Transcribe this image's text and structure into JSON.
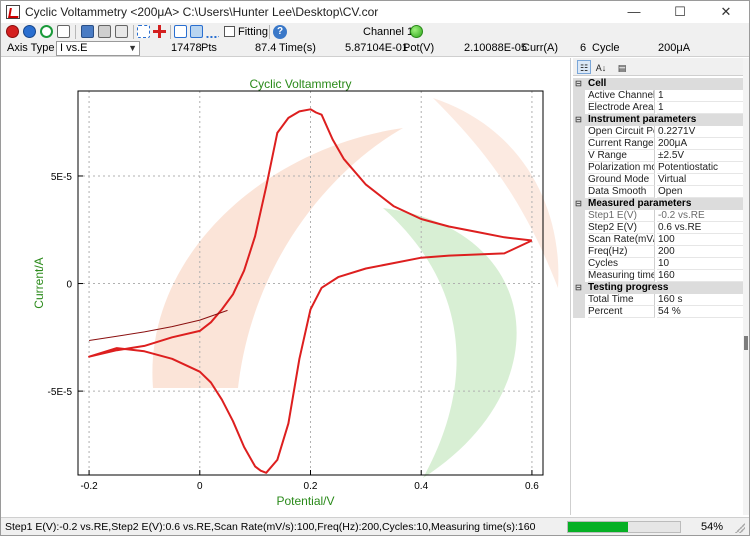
{
  "window": {
    "title": "Cyclic Voltammetry <200μA>  C:\\Users\\Hunter Lee\\Desktop\\CV.cor",
    "minimize": "—",
    "maximize": "☐",
    "close": "✕"
  },
  "toolbar": {
    "fitting_label": "Fitting",
    "help_glyph": "?",
    "channel_label": "Channel 1",
    "channel_status_color": "#2fa81c"
  },
  "infobar": {
    "axis_type_label": "Axis Type",
    "axis_type_value": "I vs.E",
    "points_value": "17478",
    "points_unit": "Pts",
    "time_value": "87.4",
    "time_unit": "Time(s)",
    "pot_value": "5.87104E-01",
    "pot_unit": "Pot(V)",
    "curr_value": "2.10088E-05",
    "curr_unit": "Curr(A)",
    "cycle_value": "6",
    "cycle_unit": "Cycle",
    "range_value": "200μA"
  },
  "chart_data": {
    "type": "line",
    "title": "Cyclic Voltammetry",
    "xlabel": "Potential/V",
    "ylabel": "Current/A",
    "xlim": [
      -0.22,
      0.62
    ],
    "ylim": [
      -8.9e-05,
      8.95e-05
    ],
    "xticks": [
      -0.2,
      0,
      0.2,
      0.4,
      0.6
    ],
    "xtick_labels": [
      "-0.2",
      "0",
      "0.2",
      "0.4",
      "0.6"
    ],
    "yticks": [
      5e-05,
      0,
      -5e-05
    ],
    "ytick_labels": [
      "5E-5",
      "0",
      "-5E-5"
    ],
    "grid": "dashed",
    "series": [
      {
        "color": "#dd1f1f",
        "x": [
          0.6,
          0.55,
          0.5,
          0.45,
          0.4,
          0.35,
          0.3,
          0.25,
          0.22,
          0.2,
          0.18,
          0.16,
          0.14,
          0.12,
          0.11,
          0.1,
          0.08,
          0.06,
          0.04,
          0.02,
          0.0,
          -0.05,
          -0.1,
          -0.15,
          -0.2,
          -0.15,
          -0.1,
          -0.05,
          0.0,
          0.02,
          0.04,
          0.06,
          0.08,
          0.1,
          0.12,
          0.14,
          0.16,
          0.18,
          0.2,
          0.21,
          0.22,
          0.24,
          0.26,
          0.3,
          0.35,
          0.4,
          0.45,
          0.5,
          0.55,
          0.6
        ],
        "y": [
          2e-05,
          1.4e-05,
          1.35e-05,
          1.3e-05,
          1.2e-05,
          9.5e-06,
          7e-06,
          3e-06,
          -2e-06,
          -1.2e-05,
          -3.5e-05,
          -6.5e-05,
          -8.2e-05,
          -8.8e-05,
          -8.7e-05,
          -8.5e-05,
          -7.6e-05,
          -6.4e-05,
          -5.4e-05,
          -4.6e-05,
          -4.1e-05,
          -3.5e-05,
          -3.15e-05,
          -3e-05,
          -3.4e-05,
          -3.1e-05,
          -2.9e-05,
          -2.5e-05,
          -2.2e-05,
          -1.8e-05,
          -1.2e-05,
          -5e-06,
          6e-06,
          2.2e-05,
          4.5e-05,
          7e-05,
          7.7e-05,
          8e-05,
          8.1e-05,
          7.95e-05,
          7.85e-05,
          6.7e-05,
          5.8e-05,
          4.6e-05,
          3.6e-05,
          3e-05,
          2.65e-05,
          2.4e-05,
          2.15e-05,
          2e-05
        ]
      },
      {
        "color": "#8a0f0f",
        "x": [
          -0.2,
          -0.15,
          -0.1,
          -0.05,
          0.0,
          0.05
        ],
        "y": [
          -2.65e-05,
          -2.45e-05,
          -2.25e-05,
          -2e-05,
          -1.7e-05,
          -1.25e-05
        ]
      }
    ]
  },
  "panel": {
    "categories": [
      {
        "title": "Cell",
        "rows": [
          {
            "name": "Active Channel",
            "value": "1",
            "readonly": false
          },
          {
            "name": "Electrode Area(c",
            "value": "1",
            "readonly": false
          }
        ]
      },
      {
        "title": "Instrument parameters",
        "rows": [
          {
            "name": "Open Circuit Pot",
            "value": "0.2271V",
            "readonly": false
          },
          {
            "name": "Current Range",
            "value": "200μA",
            "readonly": false
          },
          {
            "name": "V Range",
            "value": "±2.5V",
            "readonly": false
          },
          {
            "name": "Polarization mod",
            "value": "Potentiostatic",
            "readonly": false
          },
          {
            "name": "Ground Mode",
            "value": "Virtual",
            "readonly": false
          },
          {
            "name": "Data Smooth",
            "value": "Open",
            "readonly": false
          }
        ]
      },
      {
        "title": "Measured parameters",
        "rows": [
          {
            "name": "Step1 E(V)",
            "value": "-0.2 vs.RE",
            "readonly": true
          },
          {
            "name": "Step2 E(V)",
            "value": "0.6 vs.RE",
            "readonly": false
          },
          {
            "name": "Scan Rate(mV/s",
            "value": "100",
            "readonly": false
          },
          {
            "name": "Freq(Hz)",
            "value": "200",
            "readonly": false
          },
          {
            "name": "Cycles",
            "value": "10",
            "readonly": false
          },
          {
            "name": "Measuring time(s",
            "value": "160",
            "readonly": false
          }
        ]
      },
      {
        "title": "Testing progress",
        "rows": [
          {
            "name": "Total Time",
            "value": "160 s",
            "readonly": false
          },
          {
            "name": "Percent",
            "value": "54 %",
            "readonly": false
          }
        ]
      }
    ]
  },
  "status": {
    "text": "Step1 E(V):-0.2 vs.RE,Step2 E(V):0.6 vs.RE,Scan Rate(mV/s):100,Freq(Hz):200,Cycles:10,Measuring time(s):160",
    "progress": 0.54,
    "percent_text": "54%",
    "progress_color": "#06b025"
  }
}
